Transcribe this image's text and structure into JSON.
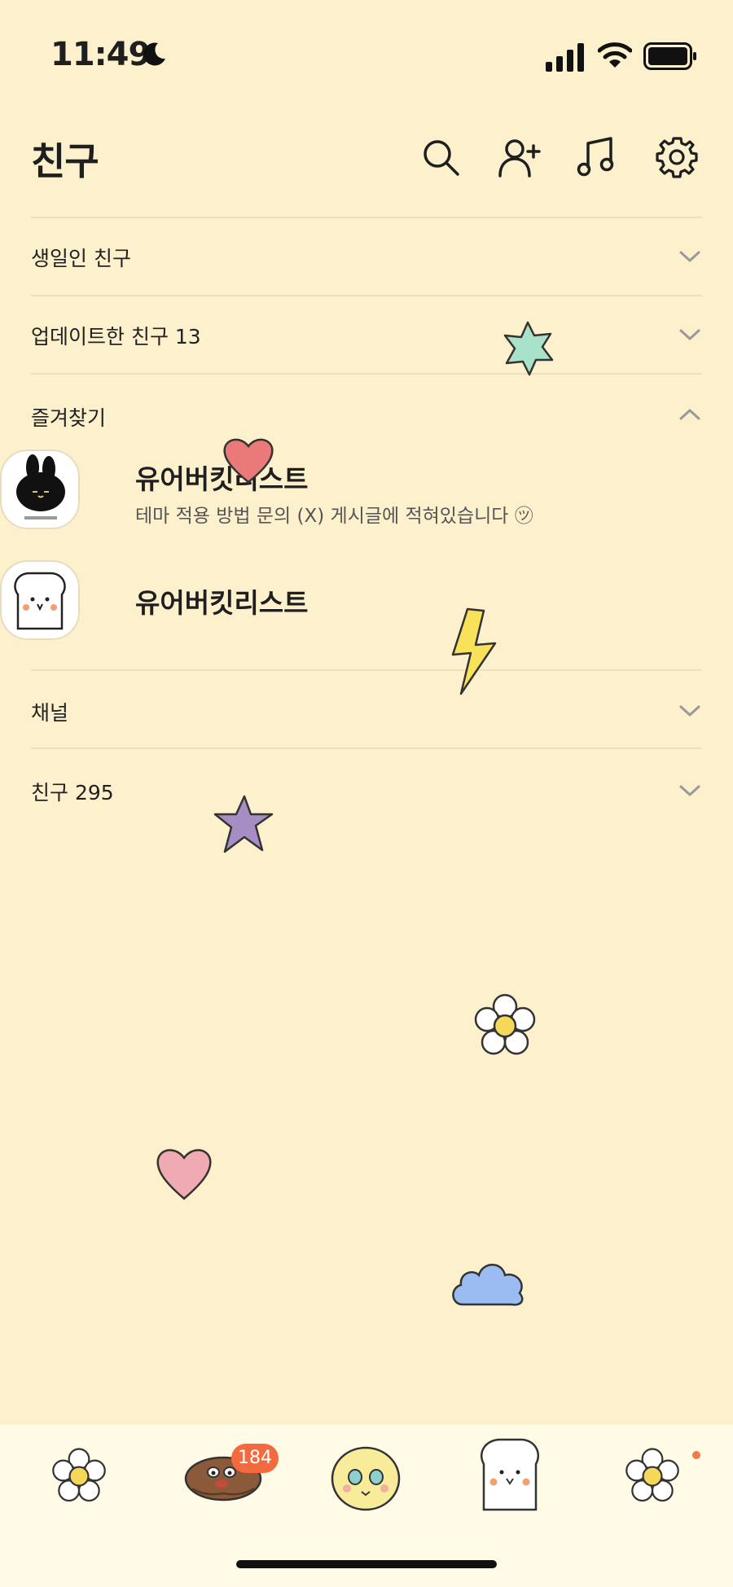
{
  "status_bar": {
    "time": "11:49"
  },
  "header": {
    "title": "친구",
    "icons": [
      "search-icon",
      "add-friend-icon",
      "music-icon",
      "settings-icon"
    ]
  },
  "sections": {
    "birthday": {
      "label": "생일인 친구"
    },
    "updated": {
      "label": "업데이트한 친구 13"
    },
    "favorites": {
      "label": "즐겨찾기",
      "items": [
        {
          "name": "유어버킷리스트",
          "status": "테마 적용 방법 문의 (X) 게시글에 적혀있습니다 ㋡"
        },
        {
          "name": "유어버킷리스트",
          "status": ""
        }
      ]
    },
    "channel": {
      "label": "채널"
    },
    "friends": {
      "label": "친구 295"
    }
  },
  "tabbar": {
    "tabs": [
      "friends-tab",
      "chats-tab",
      "openchat-tab",
      "shopping-tab",
      "more-tab"
    ],
    "chat_badge": "184"
  },
  "colors": {
    "background": "#fdf0cc",
    "tabbar": "#fffbe6",
    "badge": "#f26a3d",
    "divider": "#ece0bd"
  }
}
